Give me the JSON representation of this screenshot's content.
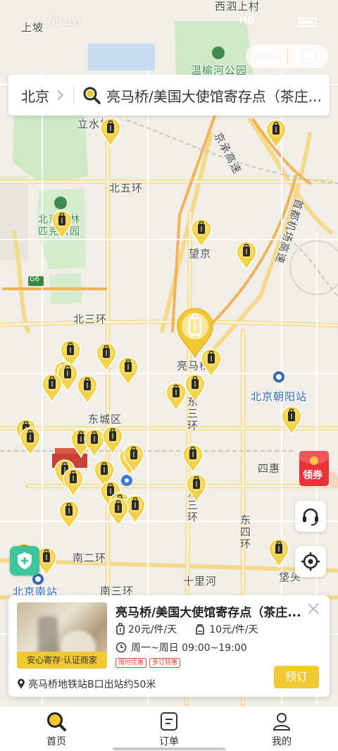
{
  "status_bar": {
    "time": "09:10",
    "network": "HD"
  },
  "map": {
    "labels": {
      "xisi": "西泗上村",
      "shangpo": "上坡",
      "wenyu": "温榆河公园",
      "lishuiqiao": "立水桥",
      "jingcheng": "京承高速",
      "beiwuhuan": "北五环",
      "airport_exp": "首都机场高速",
      "olympic": "北京奥林匹克公园",
      "wangjing": "望京",
      "g6": "G6",
      "beisanhuan": "北三环",
      "liangmaqiao": "亮马桥",
      "chaoyang_station": "北京朝阳站",
      "dongcheng": "东城区",
      "dongsanhuan": "东三环",
      "sihui": "四惠",
      "dongsihuan": "东四环",
      "nanerhuan": "南二环",
      "nansanhuan": "南三环",
      "shilihe": "十里河",
      "south_station": "北京南站",
      "baotou": "垡头"
    }
  },
  "search": {
    "city": "北京",
    "query": "亮马桥/美国大使馆寄存点（茶庄..."
  },
  "floating": {
    "coupon_label": "领券"
  },
  "card": {
    "title": "亮马桥/美国大使馆寄存点（茶庄...",
    "cert_label": "安心寄存·认证商家",
    "price_suitcase": "20元/件/天",
    "price_bag": "10元/件/天",
    "hours": "周一~周日 09:00~19:00",
    "tags": [
      "限时优惠",
      "多订特惠"
    ],
    "address": "亮马桥地铁站B口出站约50米",
    "book_label": "预订"
  },
  "nav": {
    "home": "首页",
    "orders": "订单",
    "mine": "我的"
  },
  "colors": {
    "accent": "#f0c832",
    "tag_red": "#e2453c",
    "shield_green": "#3ec59b"
  }
}
